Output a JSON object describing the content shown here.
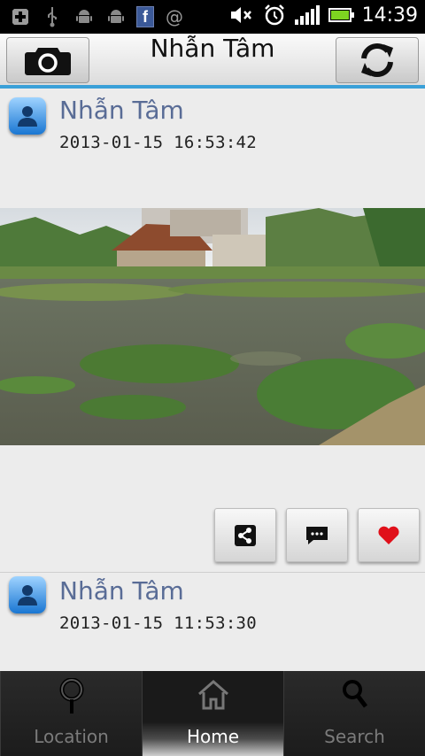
{
  "status_bar": {
    "time": "14:39",
    "icons": [
      "add-notification-icon",
      "usb-icon",
      "android-icon",
      "android-icon",
      "facebook-icon",
      "email-at-icon",
      "mute-icon",
      "alarm-icon",
      "signal-icon",
      "battery-icon"
    ],
    "facebook_glyph": "f",
    "at_glyph": "@"
  },
  "header": {
    "title": "Nhẫn Tâm",
    "left_button_icon": "camera-icon",
    "right_button_icon": "refresh-icon",
    "accent": "#3aa0d8"
  },
  "posts": [
    {
      "author": "Nhẫn Tâm",
      "timestamp": "2013-01-15 16:53:42",
      "has_photo": true,
      "actions": [
        "share-icon",
        "comment-icon",
        "like-heart-icon"
      ]
    },
    {
      "author": "Nhẫn Tâm",
      "timestamp": "2013-01-15 11:53:30"
    }
  ],
  "tabs": [
    {
      "label": "Location",
      "icon": "location-pin-icon",
      "active": false
    },
    {
      "label": "Home",
      "icon": "home-icon",
      "active": true
    },
    {
      "label": "Search",
      "icon": "search-icon",
      "active": false
    }
  ],
  "colors": {
    "author_name": "#596c96",
    "heart": "#e0101a",
    "tab_active_label": "#ffffff",
    "tab_inactive_label": "#7b7b7b"
  }
}
